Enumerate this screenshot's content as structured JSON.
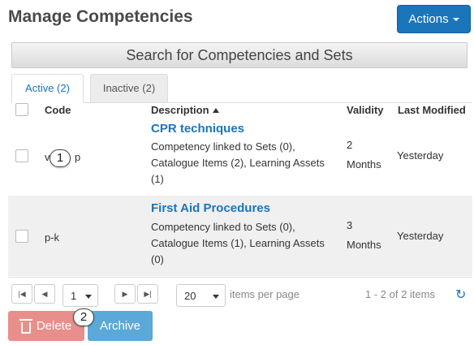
{
  "page": {
    "title": "Manage Competencies",
    "actions_label": "Actions"
  },
  "search": {
    "label": "Search for Competencies and Sets"
  },
  "tabs": [
    {
      "label": "Active (2)",
      "active": true
    },
    {
      "label": "Inactive (2)",
      "active": false
    }
  ],
  "columns": {
    "code": "Code",
    "description": "Description",
    "validity": "Validity",
    "last_modified": "Last Modified"
  },
  "rows": [
    {
      "code": "v",
      "code_tail": "p",
      "title": "CPR techniques",
      "description": [
        "Competency linked to Sets (0),",
        "Catalogue Items (2), Learning Assets",
        "(1)"
      ],
      "validity": [
        "2",
        "Months"
      ],
      "last_modified": "Yesterday"
    },
    {
      "code": "p-k",
      "title": "First Aid Procedures",
      "description": [
        "Competency linked to Sets (0),",
        "Catalogue Items (1), Learning Assets",
        "(0)"
      ],
      "validity": [
        "3",
        "Months"
      ],
      "last_modified": "Yesterday"
    }
  ],
  "pager": {
    "page": "1",
    "page_size": "20",
    "items_per_page_label": "items per page",
    "summary": "1 - 2 of 2 items"
  },
  "buttons": {
    "delete": "Delete",
    "archive": "Archive"
  },
  "markers": [
    "1",
    "2"
  ],
  "colors": {
    "accent": "#1a75bb",
    "delete": "#e88f8b",
    "archive": "#5aa9d8"
  }
}
